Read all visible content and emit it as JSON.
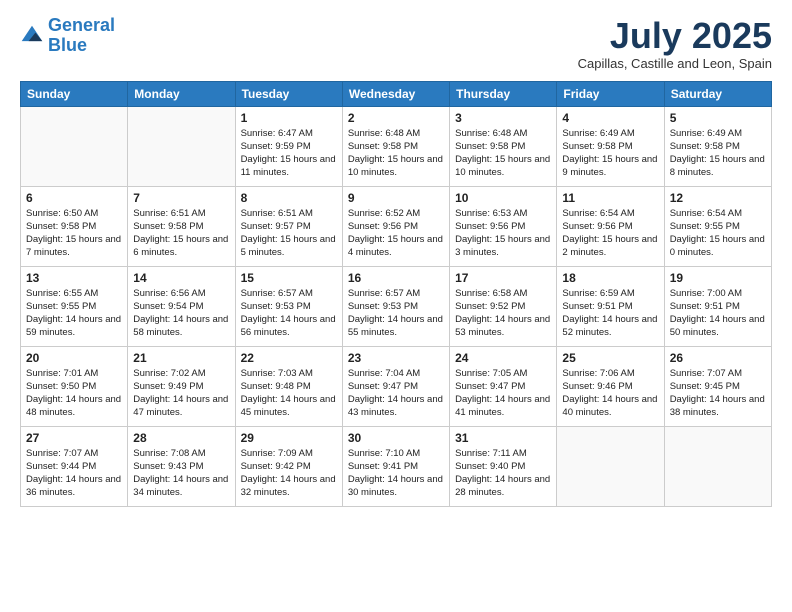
{
  "logo": {
    "line1": "General",
    "line2": "Blue"
  },
  "title": "July 2025",
  "location": "Capillas, Castille and Leon, Spain",
  "weekdays": [
    "Sunday",
    "Monday",
    "Tuesday",
    "Wednesday",
    "Thursday",
    "Friday",
    "Saturday"
  ],
  "weeks": [
    [
      {
        "day": "",
        "info": ""
      },
      {
        "day": "",
        "info": ""
      },
      {
        "day": "1",
        "info": "Sunrise: 6:47 AM\nSunset: 9:59 PM\nDaylight: 15 hours and 11 minutes."
      },
      {
        "day": "2",
        "info": "Sunrise: 6:48 AM\nSunset: 9:58 PM\nDaylight: 15 hours and 10 minutes."
      },
      {
        "day": "3",
        "info": "Sunrise: 6:48 AM\nSunset: 9:58 PM\nDaylight: 15 hours and 10 minutes."
      },
      {
        "day": "4",
        "info": "Sunrise: 6:49 AM\nSunset: 9:58 PM\nDaylight: 15 hours and 9 minutes."
      },
      {
        "day": "5",
        "info": "Sunrise: 6:49 AM\nSunset: 9:58 PM\nDaylight: 15 hours and 8 minutes."
      }
    ],
    [
      {
        "day": "6",
        "info": "Sunrise: 6:50 AM\nSunset: 9:58 PM\nDaylight: 15 hours and 7 minutes."
      },
      {
        "day": "7",
        "info": "Sunrise: 6:51 AM\nSunset: 9:58 PM\nDaylight: 15 hours and 6 minutes."
      },
      {
        "day": "8",
        "info": "Sunrise: 6:51 AM\nSunset: 9:57 PM\nDaylight: 15 hours and 5 minutes."
      },
      {
        "day": "9",
        "info": "Sunrise: 6:52 AM\nSunset: 9:56 PM\nDaylight: 15 hours and 4 minutes."
      },
      {
        "day": "10",
        "info": "Sunrise: 6:53 AM\nSunset: 9:56 PM\nDaylight: 15 hours and 3 minutes."
      },
      {
        "day": "11",
        "info": "Sunrise: 6:54 AM\nSunset: 9:56 PM\nDaylight: 15 hours and 2 minutes."
      },
      {
        "day": "12",
        "info": "Sunrise: 6:54 AM\nSunset: 9:55 PM\nDaylight: 15 hours and 0 minutes."
      }
    ],
    [
      {
        "day": "13",
        "info": "Sunrise: 6:55 AM\nSunset: 9:55 PM\nDaylight: 14 hours and 59 minutes."
      },
      {
        "day": "14",
        "info": "Sunrise: 6:56 AM\nSunset: 9:54 PM\nDaylight: 14 hours and 58 minutes."
      },
      {
        "day": "15",
        "info": "Sunrise: 6:57 AM\nSunset: 9:53 PM\nDaylight: 14 hours and 56 minutes."
      },
      {
        "day": "16",
        "info": "Sunrise: 6:57 AM\nSunset: 9:53 PM\nDaylight: 14 hours and 55 minutes."
      },
      {
        "day": "17",
        "info": "Sunrise: 6:58 AM\nSunset: 9:52 PM\nDaylight: 14 hours and 53 minutes."
      },
      {
        "day": "18",
        "info": "Sunrise: 6:59 AM\nSunset: 9:51 PM\nDaylight: 14 hours and 52 minutes."
      },
      {
        "day": "19",
        "info": "Sunrise: 7:00 AM\nSunset: 9:51 PM\nDaylight: 14 hours and 50 minutes."
      }
    ],
    [
      {
        "day": "20",
        "info": "Sunrise: 7:01 AM\nSunset: 9:50 PM\nDaylight: 14 hours and 48 minutes."
      },
      {
        "day": "21",
        "info": "Sunrise: 7:02 AM\nSunset: 9:49 PM\nDaylight: 14 hours and 47 minutes."
      },
      {
        "day": "22",
        "info": "Sunrise: 7:03 AM\nSunset: 9:48 PM\nDaylight: 14 hours and 45 minutes."
      },
      {
        "day": "23",
        "info": "Sunrise: 7:04 AM\nSunset: 9:47 PM\nDaylight: 14 hours and 43 minutes."
      },
      {
        "day": "24",
        "info": "Sunrise: 7:05 AM\nSunset: 9:47 PM\nDaylight: 14 hours and 41 minutes."
      },
      {
        "day": "25",
        "info": "Sunrise: 7:06 AM\nSunset: 9:46 PM\nDaylight: 14 hours and 40 minutes."
      },
      {
        "day": "26",
        "info": "Sunrise: 7:07 AM\nSunset: 9:45 PM\nDaylight: 14 hours and 38 minutes."
      }
    ],
    [
      {
        "day": "27",
        "info": "Sunrise: 7:07 AM\nSunset: 9:44 PM\nDaylight: 14 hours and 36 minutes."
      },
      {
        "day": "28",
        "info": "Sunrise: 7:08 AM\nSunset: 9:43 PM\nDaylight: 14 hours and 34 minutes."
      },
      {
        "day": "29",
        "info": "Sunrise: 7:09 AM\nSunset: 9:42 PM\nDaylight: 14 hours and 32 minutes."
      },
      {
        "day": "30",
        "info": "Sunrise: 7:10 AM\nSunset: 9:41 PM\nDaylight: 14 hours and 30 minutes."
      },
      {
        "day": "31",
        "info": "Sunrise: 7:11 AM\nSunset: 9:40 PM\nDaylight: 14 hours and 28 minutes."
      },
      {
        "day": "",
        "info": ""
      },
      {
        "day": "",
        "info": ""
      }
    ]
  ]
}
